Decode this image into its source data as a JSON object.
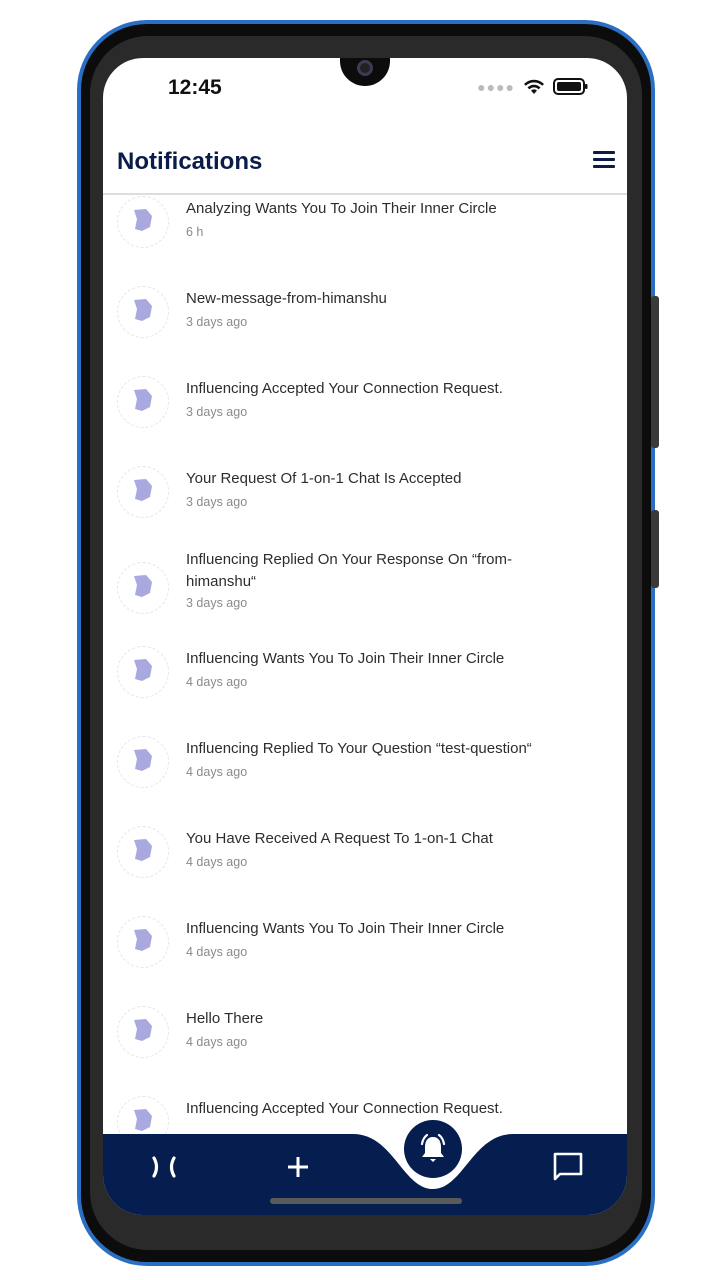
{
  "status_bar": {
    "time": "12:45"
  },
  "header": {
    "title": "Notifications"
  },
  "notifications": [
    {
      "title": "Analyzing Wants You To Join Their Inner Circle",
      "time": "6 h"
    },
    {
      "title": "New-message-from-himanshu",
      "time": "3 days ago"
    },
    {
      "title": "Influencing Accepted Your Connection Request.",
      "time": "3 days ago"
    },
    {
      "title": "Your Request Of 1-on-1 Chat Is Accepted",
      "time": "3 days ago"
    },
    {
      "title": "Influencing  Replied On Your Response On “from-himanshu“",
      "time": "3 days ago"
    },
    {
      "title": "Influencing Wants You To Join Their Inner Circle",
      "time": "4 days ago"
    },
    {
      "title": "Influencing Replied To Your Question “test-question“",
      "time": "4 days ago"
    },
    {
      "title": "You Have Received A Request To 1-on-1 Chat",
      "time": "4 days ago"
    },
    {
      "title": "Influencing Wants You To Join Their Inner Circle",
      "time": "4 days ago"
    },
    {
      "title": "Hello There",
      "time": "4 days ago"
    },
    {
      "title": "Influencing Accepted Your Connection Request.",
      "time": ""
    }
  ],
  "bottom_nav": {
    "items": [
      "home-icon",
      "add-icon",
      "bell-icon",
      "chat-icon"
    ],
    "active": "bell-icon"
  },
  "colors": {
    "primary": "#061d4f",
    "avatar_fill": "#a9a9e0",
    "phone_frame": "#2a6fc4"
  }
}
